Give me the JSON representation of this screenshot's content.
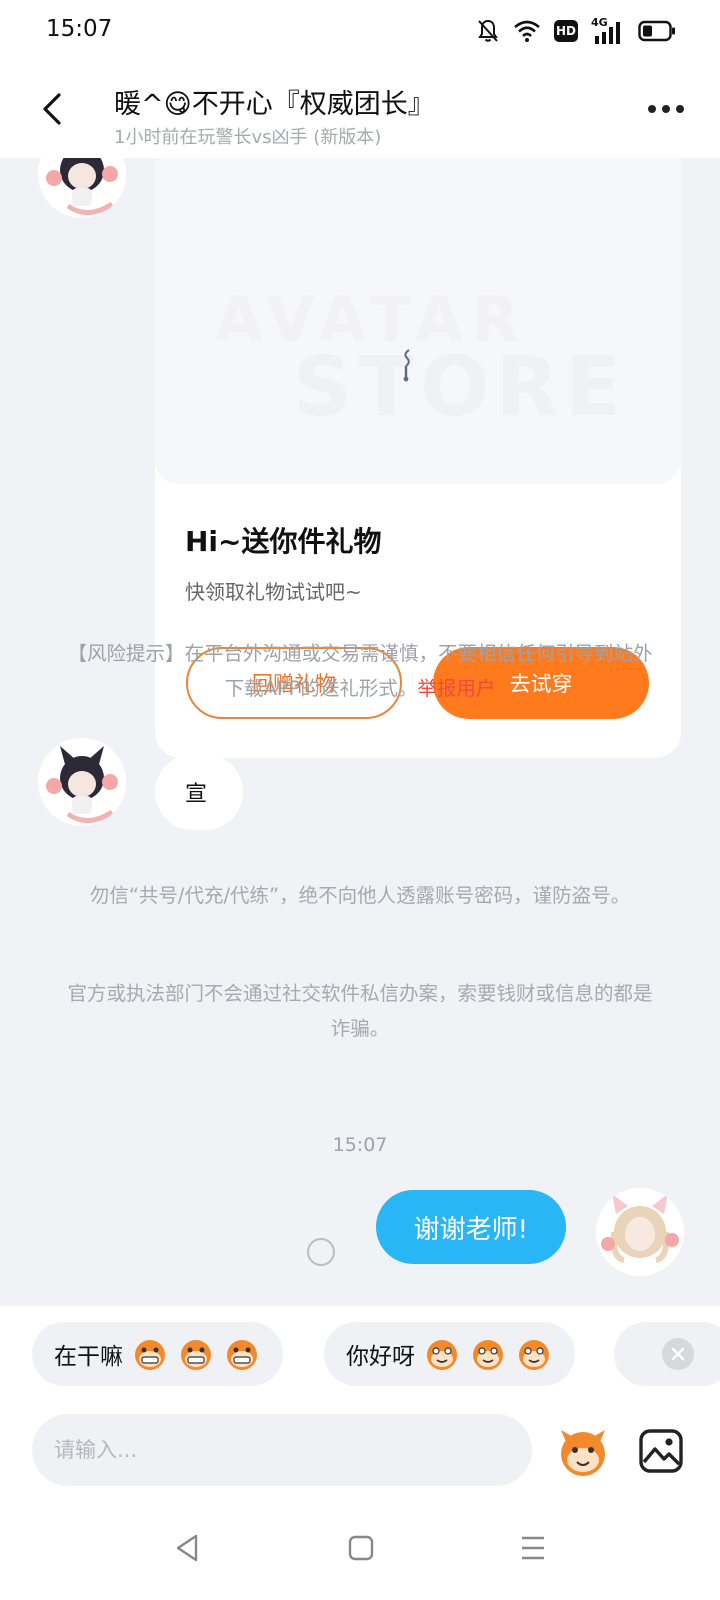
{
  "status_bar": {
    "time": "15:07",
    "icons": [
      "bell-off-icon",
      "wifi-icon",
      "hd-icon",
      "signal-4g-icon",
      "battery-icon"
    ],
    "hd_label": "HD",
    "network_label": "4G"
  },
  "header": {
    "title": "暖^😋不开心『权威团长』",
    "subtitle": "1小时前在玩警长vs凶手 (新版本)"
  },
  "gift_card": {
    "banner_line1": "AVATAR",
    "banner_line2": "STORE",
    "title": "Hi~送你件礼物",
    "subtitle": "快领取礼物试试吧~",
    "return_gift_label": "回赠礼物",
    "try_on_label": "去试穿"
  },
  "risk_notice": {
    "text": "【风险提示】在平台外沟通或交易需谨慎，不要相信任何引导到站外下载APP的送礼形式。",
    "link_label": "举报用户"
  },
  "messages": {
    "received": "宣",
    "notice_1": "勿信“共号/代充/代练”，绝不向他人透露账号密码，谨防盗号。",
    "notice_2": "官方或执法部门不会通过社交软件私信办案，索要钱财或信息的都是诈骗。",
    "timestamp": "15:07",
    "sent": "谢谢老师!"
  },
  "quick_replies": [
    {
      "label": "在干嘛"
    },
    {
      "label": "你好呀"
    }
  ],
  "input": {
    "placeholder": "请输入..."
  },
  "colors": {
    "accent_orange": "#ff7a1c",
    "sent_bubble": "#29b6f6",
    "report_link": "#f0493e"
  }
}
